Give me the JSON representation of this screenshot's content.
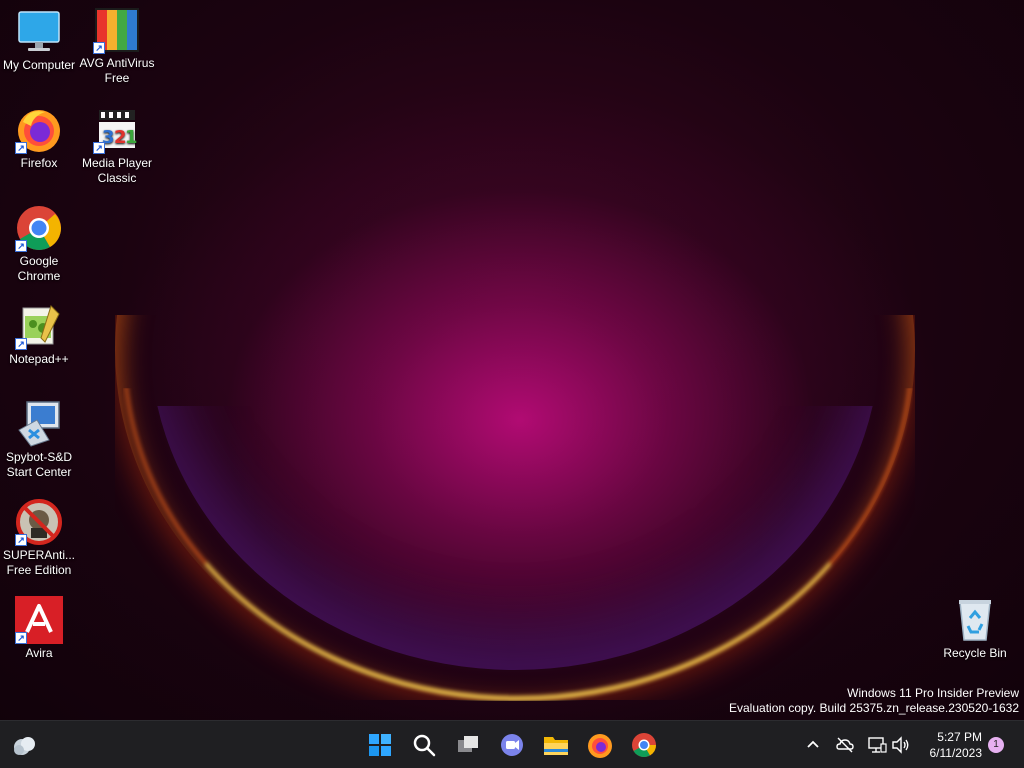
{
  "desktop_icons": [
    {
      "label": "My Computer",
      "icon": "monitor-icon"
    },
    {
      "label": "AVG AntiVirus Free",
      "icon": "avg-icon"
    },
    {
      "label": "Firefox",
      "icon": "firefox-icon"
    },
    {
      "label": "Media Player Classic",
      "icon": "media-player-icon"
    },
    {
      "label": "Google Chrome",
      "icon": "chrome-icon"
    },
    {
      "label": "Notepad++",
      "icon": "notepad-icon"
    },
    {
      "label": "Spybot-S&D Start Center",
      "icon": "spybot-icon"
    },
    {
      "label": "SUPERAnti... Free Edition",
      "icon": "superantispyware-icon"
    },
    {
      "label": "Avira",
      "icon": "avira-icon"
    },
    {
      "label": "Recycle Bin",
      "icon": "recycle-bin-icon"
    }
  ],
  "watermark": {
    "line1": "Windows 11 Pro Insider Preview",
    "line2": "Evaluation copy. Build 25375.zn_release.230520-1632"
  },
  "taskbar": {
    "pinned": [
      "start-icon",
      "search-icon",
      "task-view-icon",
      "teams-chat-icon",
      "file-explorer-icon",
      "firefox-icon",
      "chrome-icon"
    ],
    "clock_time": "5:27 PM",
    "clock_date": "6/11/2023",
    "notification_count": "1",
    "tray": [
      "chevron-up-icon",
      "cloud-offline-icon",
      "network-icon",
      "volume-icon"
    ]
  },
  "colors": {
    "taskbar_bg": "#1f1f22",
    "accent_blue": "#0a84ff"
  }
}
